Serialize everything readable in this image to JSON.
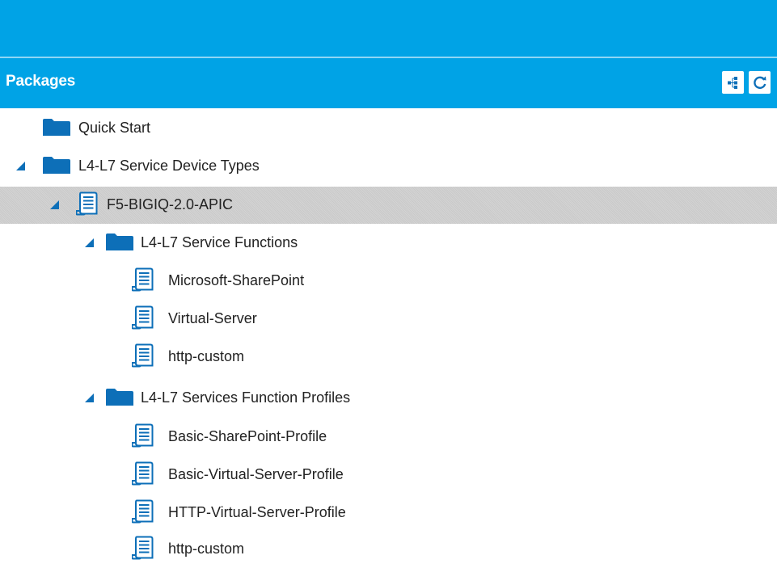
{
  "header": {
    "title": "Packages",
    "buttons": [
      {
        "icon": "tree-layout-icon"
      },
      {
        "icon": "refresh-icon"
      }
    ]
  },
  "colors": {
    "accent": "#00a3e6",
    "icon_blue": "#0d6fb8",
    "selected_bg": "#cfcfcf"
  },
  "tree": [
    {
      "label": "Quick Start",
      "icon": "folder-icon",
      "expanded": false
    },
    {
      "label": "L4-L7 Service Device Types",
      "icon": "folder-icon",
      "expanded": true
    },
    {
      "label": "F5-BIGIQ-2.0-APIC",
      "icon": "scroll-icon",
      "expanded": true,
      "selected": true
    },
    {
      "label": "L4-L7 Service Functions",
      "icon": "folder-icon",
      "expanded": true
    },
    {
      "label": "Microsoft-SharePoint",
      "icon": "scroll-icon"
    },
    {
      "label": "Virtual-Server",
      "icon": "scroll-icon"
    },
    {
      "label": "http-custom",
      "icon": "scroll-icon"
    },
    {
      "label": "L4-L7 Services Function Profiles",
      "icon": "folder-icon",
      "expanded": true
    },
    {
      "label": "Basic-SharePoint-Profile",
      "icon": "scroll-icon"
    },
    {
      "label": "Basic-Virtual-Server-Profile",
      "icon": "scroll-icon"
    },
    {
      "label": "HTTP-Virtual-Server-Profile",
      "icon": "scroll-icon"
    },
    {
      "label": "http-custom",
      "icon": "scroll-icon"
    }
  ]
}
